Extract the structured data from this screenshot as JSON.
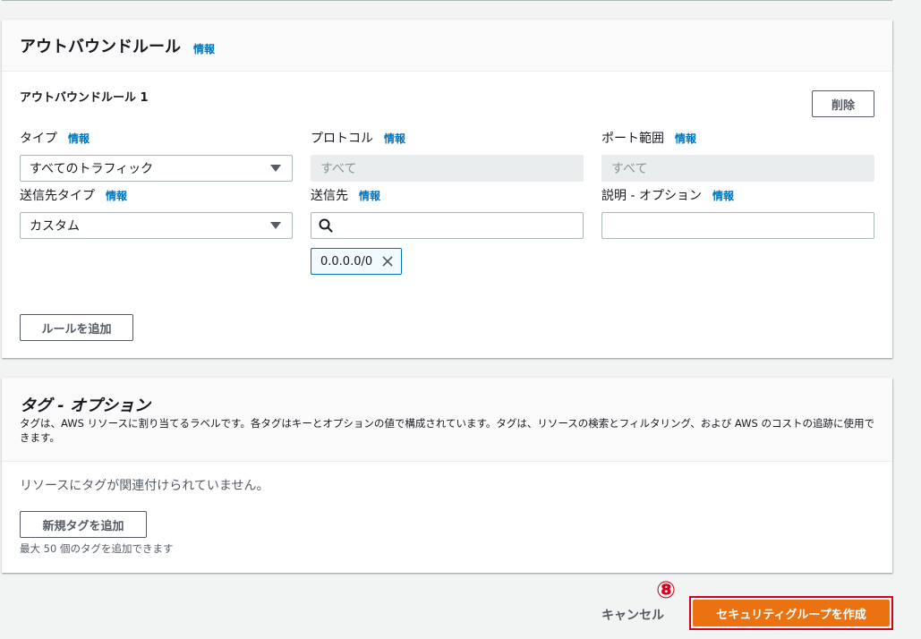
{
  "outbound": {
    "title": "アウトバウンドルール",
    "info": "情報",
    "rule_title": "アウトバウンドルール 1",
    "delete_label": "削除",
    "type": {
      "label": "タイプ",
      "info": "情報",
      "value": "すべてのトラフィック"
    },
    "protocol": {
      "label": "プロトコル",
      "info": "情報",
      "value": "すべて"
    },
    "port_range": {
      "label": "ポート範囲",
      "info": "情報",
      "value": "すべて"
    },
    "dest_type": {
      "label": "送信先タイプ",
      "info": "情報",
      "value": "カスタム"
    },
    "destination": {
      "label": "送信先",
      "info": "情報",
      "value": "",
      "token": "0.0.0.0/0"
    },
    "description": {
      "label": "説明 - オプション",
      "info": "情報",
      "value": ""
    },
    "add_rule_label": "ルールを追加"
  },
  "tags": {
    "title": "タグ - オプション",
    "description": "タグは、AWS リソースに割り当てるラベルです。各タグはキーとオプションの値で構成されています。タグは、リソースの検索とフィルタリング、および AWS のコストの追跡に使用できます。",
    "empty_text": "リソースにタグが関連付けられていません。",
    "add_tag_label": "新規タグを追加",
    "hint": "最大 50 個のタグを追加できます"
  },
  "footer": {
    "step_marker": "⑧",
    "cancel_label": "キャンセル",
    "create_label": "セキュリティグループを作成"
  },
  "colors": {
    "primary": "#ec7211",
    "link": "#0073bb",
    "highlight": "#d0021b"
  }
}
